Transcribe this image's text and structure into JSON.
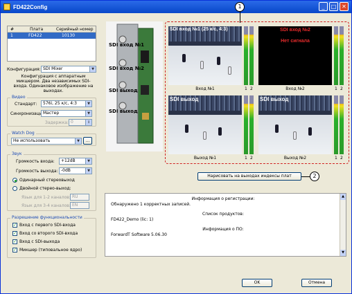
{
  "window": {
    "title": "FD422Config"
  },
  "boards_table": {
    "columns": [
      "#",
      "Плата",
      "Серийный номер"
    ],
    "rows": [
      {
        "num": "1",
        "board": "FD422",
        "serial": "10130"
      }
    ]
  },
  "board_labels": [
    "SDI вход №1",
    "SDI вход №2",
    "SDI выход",
    "SDI выход"
  ],
  "config": {
    "label": "Конфигурация:",
    "value": "SDI Mixer",
    "description": "Конфигурация с аппаратным микшером. Два независимых SDI-входа. Одинаковое изображение на выходах."
  },
  "video": {
    "title": "Видео",
    "standard_label": "Стандарт:",
    "standard_value": "576i, 25 к/с, 4:3",
    "sync_label": "Синхронизация:",
    "sync_value": "Мастер",
    "delay_label": "Задержка:",
    "delay_value": "0"
  },
  "watchdog": {
    "title": "Watch Dog",
    "value": "Не использовать",
    "more": "..."
  },
  "sound": {
    "title": "Звук",
    "in_vol_label": "Громкость входа:",
    "in_vol_value": "+12dB",
    "out_vol_label": "Громкость выхода:",
    "out_vol_value": "-0dB",
    "single_stereo": "Одинарный стереовыход",
    "double_stereo": "Двойной стерео-выход:",
    "lang12_label": "Язык для 1-2 каналов:",
    "lang12_value": "RU",
    "lang34_label": "Язык для 3-4 каналов:",
    "lang34_value": "EN"
  },
  "features": {
    "title": "Разрешение функциональности",
    "items": [
      "Вход с первого SDI-входа",
      "Вход со второго SDI-входа",
      "Вход с SDI-выхода",
      "Микшер (типовальное ядро)"
    ]
  },
  "previews": [
    {
      "overlay": "SDI вход №1 (25 к/с, 4:3)",
      "caption": "Вход №1",
      "level1": 0.85,
      "level2": 0.85
    },
    {
      "overlay": "SDI вход №2",
      "status": "Нет сигнала",
      "caption": "Вход №2",
      "level1": 0.85,
      "level2": 0.85
    },
    {
      "overlay": "SDI выход",
      "caption": "Выход №1",
      "level1": 0.85,
      "level2": 0.85
    },
    {
      "overlay": "SDI выход",
      "caption": "Выход №2",
      "level1": 0.85,
      "level2": 0.85
    }
  ],
  "meter_channels": [
    "1",
    "2"
  ],
  "draw_index_button": "Нарисовать на выходах индексы плат",
  "callouts": [
    "1",
    "2"
  ],
  "registration": {
    "line1": "Информация о регистрации:",
    "line2": "Обнаружено 1 корректных записей.",
    "line3": "Список продуктов:",
    "line4": "FD422_Demo (lic: 1)",
    "line5": "Информация о ПО:",
    "line6": "ForwardT Software 5.06.30"
  },
  "buttons": {
    "ok": "OK",
    "cancel": "Отмена"
  }
}
